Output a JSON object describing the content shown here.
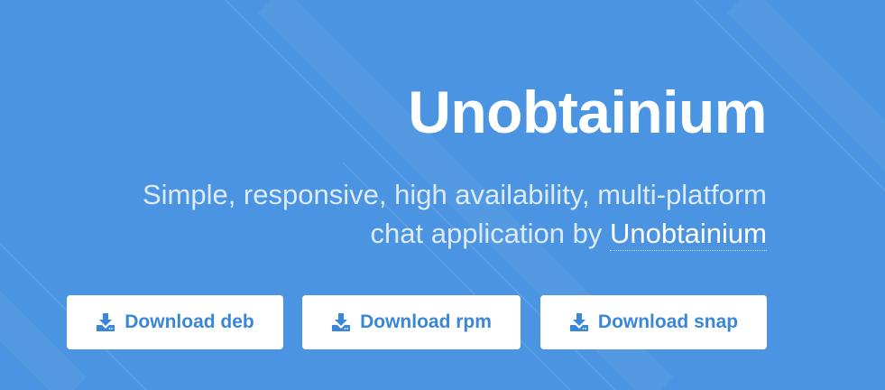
{
  "hero": {
    "title": "Unobtainium",
    "tagline_line1": "Simple, responsive, high availability, multi-platform",
    "tagline_line2_prefix": "chat application by ",
    "tagline_link": "Unobtainium",
    "background_color": "#4a94e2"
  },
  "downloads": [
    {
      "label": "Download deb",
      "icon": "download-icon"
    },
    {
      "label": "Download rpm",
      "icon": "download-icon"
    },
    {
      "label": "Download snap",
      "icon": "download-icon"
    }
  ],
  "colors": {
    "button_text": "#3a86d8",
    "button_bg": "#ffffff",
    "tagline_text": "#ddeafa"
  }
}
